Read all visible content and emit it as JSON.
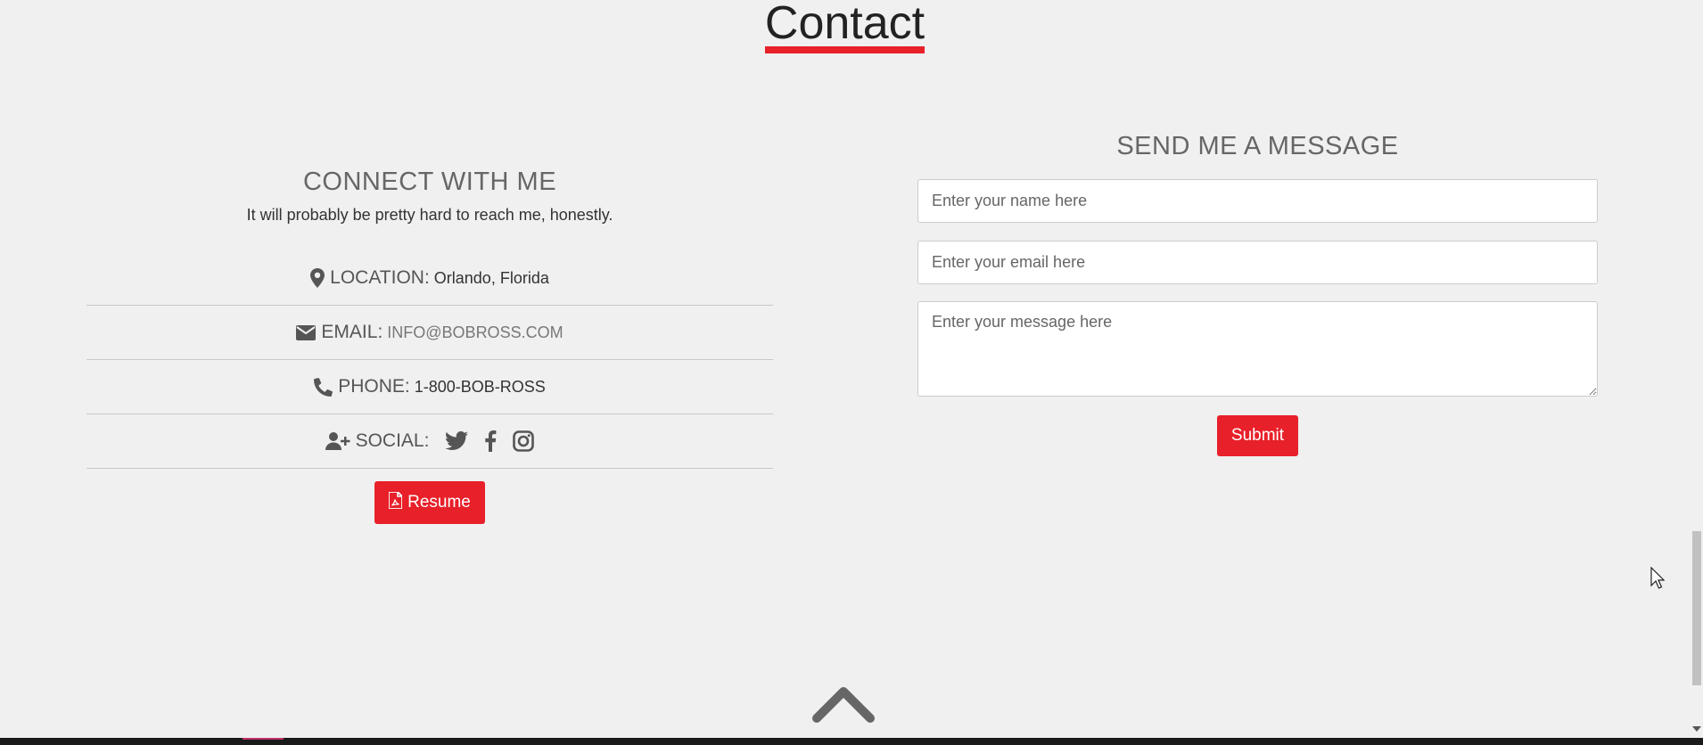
{
  "section": {
    "title": "Contact"
  },
  "connect": {
    "heading": "CONNECT WITH ME",
    "tagline": "It will probably be pretty hard to reach me, honestly.",
    "location": {
      "label": "LOCATION:",
      "value": "Orlando, Florida",
      "icon": "map-marker-icon"
    },
    "email": {
      "label": "EMAIL:",
      "value": "INFO@BOBROSS.COM",
      "icon": "envelope-icon"
    },
    "phone": {
      "label": "PHONE:",
      "value": "1-800-BOB-ROSS",
      "icon": "phone-icon"
    },
    "social": {
      "label": "SOCIAL:",
      "icon": "user-plus-icon",
      "links": [
        "twitter-icon",
        "facebook-icon",
        "instagram-icon"
      ]
    },
    "resume_label": "Resume"
  },
  "message": {
    "heading": "SEND ME A MESSAGE",
    "name_placeholder": "Enter your name here",
    "email_placeholder": "Enter your email here",
    "message_placeholder": "Enter your message here",
    "submit_label": "Submit"
  },
  "colors": {
    "accent": "#e8202a",
    "background": "#f0f0f0",
    "text": "#555555"
  }
}
